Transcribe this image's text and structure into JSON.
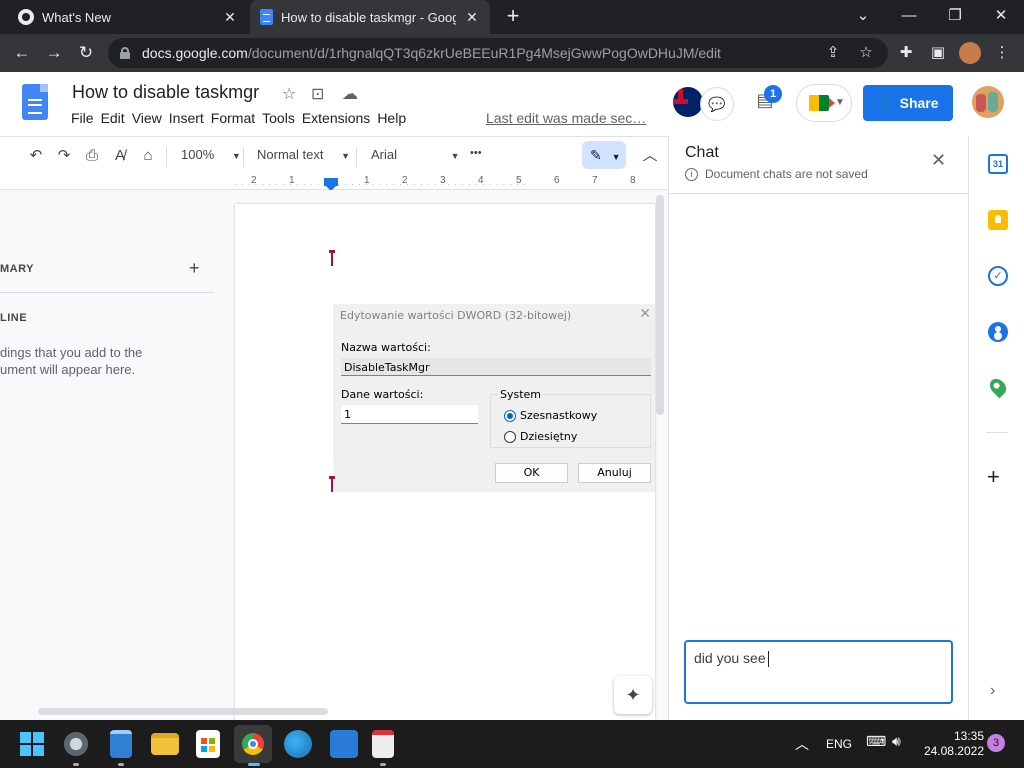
{
  "browser": {
    "tabs": [
      {
        "title": "What's New",
        "close": "✕"
      },
      {
        "title": "How to disable taskmgr - Google",
        "close": "✕"
      }
    ],
    "new_tab": "+",
    "window_controls": {
      "minimize": "—",
      "restore": "❐",
      "close": "✕",
      "tab_search": "⌄"
    },
    "url_domain": "docs.google.com",
    "url_path": "/document/d/1rhgnalqQT3q6zkrUeBEEuR1Pg4MsejGwwPogOwDHuJM/edit"
  },
  "docs": {
    "title": "How to disable taskmgr",
    "menu": [
      "File",
      "Edit",
      "View",
      "Insert",
      "Format",
      "Tools",
      "Extensions",
      "Help"
    ],
    "last_edit": "Last edit was made sec…",
    "comment_count": "1",
    "share_label": "Share"
  },
  "toolbar": {
    "zoom": "100%",
    "style": "Normal text",
    "font": "Arial",
    "more": "•••"
  },
  "ruler": [
    "2",
    "1",
    "1",
    "2",
    "3",
    "4",
    "5",
    "6",
    "7",
    "8"
  ],
  "outline": {
    "summary_label": "MARY",
    "outline_label": "LINE",
    "hint": "dings that you add to the ument will appear here."
  },
  "dialog": {
    "title": "Edytowanie wartości DWORD (32-bitowej)",
    "name_label": "Nazwa wartości:",
    "name_value": "DisableTaskMgr",
    "data_label": "Dane wartości:",
    "data_value": "1",
    "system_label": "System",
    "radio_hex": "Szesnastkowy",
    "radio_dec": "Dziesiętny",
    "ok": "OK",
    "cancel": "Anuluj"
  },
  "chat": {
    "title": "Chat",
    "note": "Document chats are not saved",
    "input_text": "did you see"
  },
  "sidepanel": {
    "calendar_day": "31"
  },
  "taskbar": {
    "lang": "ENG",
    "time": "13:35",
    "date": "24.08.2022",
    "notifications": "3"
  }
}
